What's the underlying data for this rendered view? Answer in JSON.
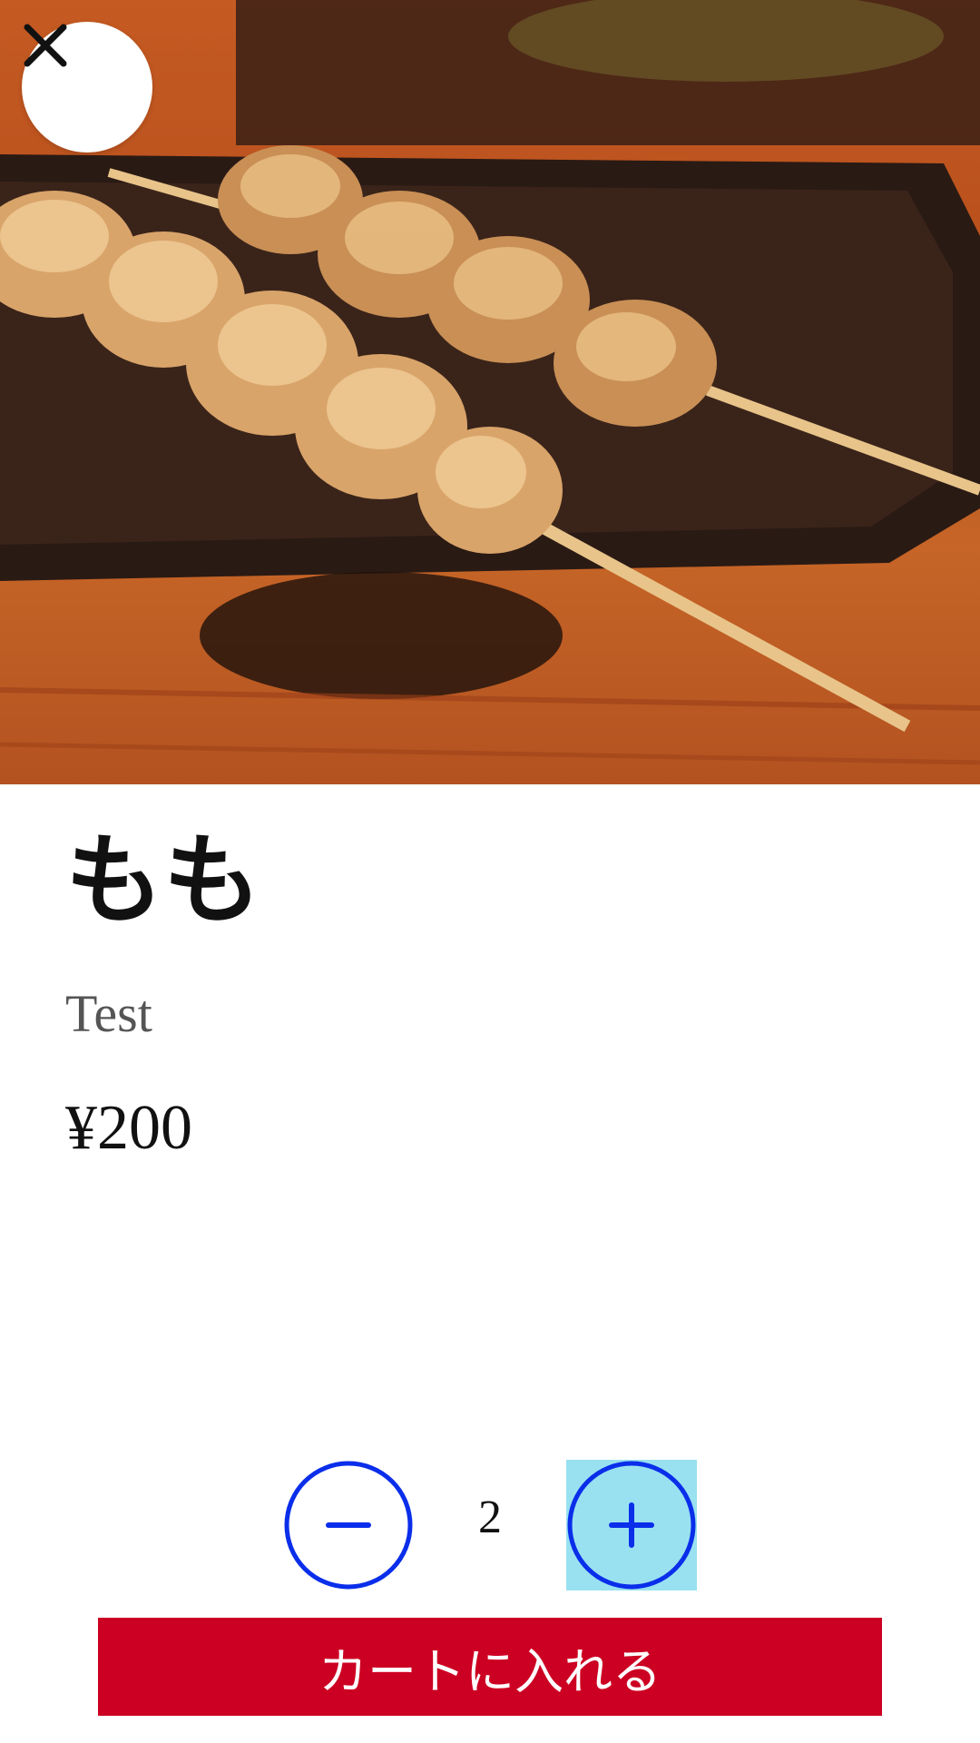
{
  "item": {
    "name": "もも",
    "description": "Test",
    "price": "¥200",
    "image_alt": "yakitori-skewers-photo"
  },
  "quantity": {
    "value": "2"
  },
  "actions": {
    "add_to_cart_label": "カートに入れる"
  },
  "icons": {
    "close": "close-icon",
    "minus": "minus-circle-icon",
    "plus": "plus-circle-icon"
  },
  "colors": {
    "accent_blue": "#0a2eea",
    "cart_red": "#cc0022",
    "plus_highlight": "#99e1f1"
  }
}
